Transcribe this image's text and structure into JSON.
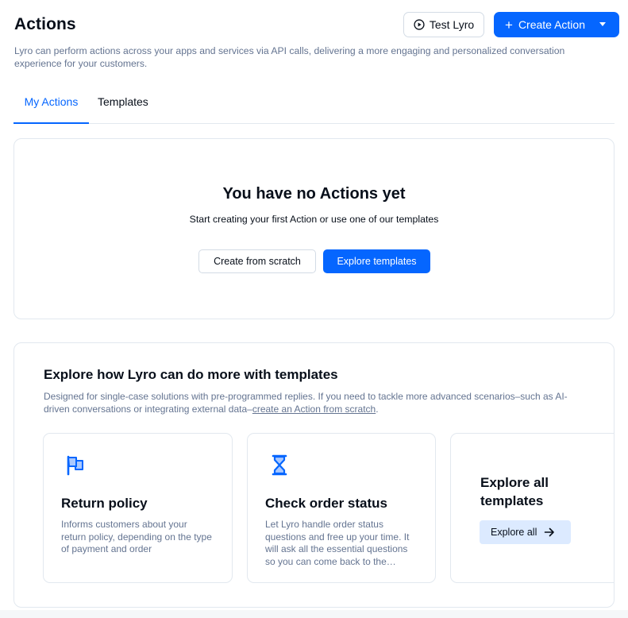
{
  "header": {
    "title": "Actions",
    "description": "Lyro can perform actions across your apps and services via API calls, delivering a more engaging and personalized conversation experience for your customers.",
    "test_button": "Test Lyro",
    "create_button": "Create Action"
  },
  "tabs": [
    {
      "label": "My Actions",
      "active": true
    },
    {
      "label": "Templates",
      "active": false
    }
  ],
  "empty_state": {
    "title": "You have no Actions yet",
    "subtitle": "Start creating your first Action or use one of our templates",
    "scratch_button": "Create from scratch",
    "explore_button": "Explore templates"
  },
  "templates_section": {
    "heading": "Explore how Lyro can do more with templates",
    "description_prefix": "Designed for single-case solutions with pre-programmed replies. If you need to tackle more advanced scenarios–such as AI-driven conversations or integrating external data–",
    "description_link": "create an Action from scratch",
    "description_suffix": ".",
    "cards": [
      {
        "icon": "flag-icon",
        "title": "Return policy",
        "description": "Informs customers about your return policy, depending on the type of payment and order"
      },
      {
        "icon": "hourglass-icon",
        "title": "Check order status",
        "description": "Let Lyro handle order status questions and free up your time. It will ask all the essential questions so you can come back to the customer with the answer."
      }
    ],
    "explore_all": {
      "title": "Explore all templates",
      "button": "Explore all"
    }
  },
  "colors": {
    "primary": "#0566ff",
    "text": "#080f1a",
    "muted": "#647491",
    "border": "#e2e8ef",
    "light_blue": "#dceaff"
  }
}
